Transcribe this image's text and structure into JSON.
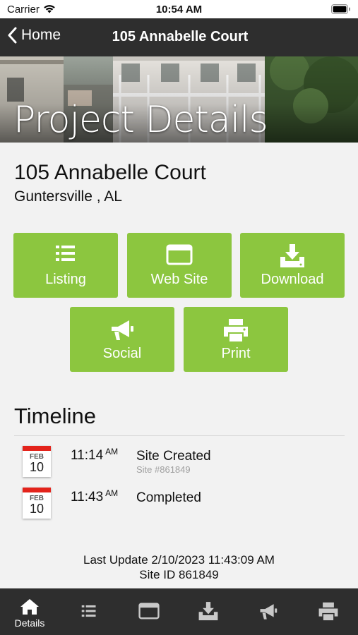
{
  "status_bar": {
    "carrier": "Carrier",
    "time": "10:54 AM"
  },
  "nav": {
    "back_label": "Home",
    "title": "105 Annabelle Court"
  },
  "hero": {
    "title": "Project Details"
  },
  "project": {
    "address": "105 Annabelle Court",
    "city": "Guntersville , AL"
  },
  "actions": [
    {
      "label": "Listing",
      "icon": "list-icon"
    },
    {
      "label": "Web Site",
      "icon": "browser-window-icon"
    },
    {
      "label": "Download",
      "icon": "download-icon"
    },
    {
      "label": "Social",
      "icon": "megaphone-icon"
    },
    {
      "label": "Print",
      "icon": "printer-icon"
    }
  ],
  "timeline": {
    "heading": "Timeline",
    "events": [
      {
        "month": "FEB",
        "day": "10",
        "time": "11:14",
        "ampm": "AM",
        "title": "Site Created",
        "subtitle": "Site #861849"
      },
      {
        "month": "FEB",
        "day": "10",
        "time": "11:43",
        "ampm": "AM",
        "title": "Completed",
        "subtitle": ""
      }
    ]
  },
  "footer": {
    "last_update": "Last Update 2/10/2023 11:43:09 AM",
    "site_id": "Site ID 861849"
  },
  "tab_bar": {
    "items": [
      {
        "label": "Details",
        "icon": "home-icon",
        "active": true
      },
      {
        "label": "",
        "icon": "list-icon"
      },
      {
        "label": "",
        "icon": "browser-window-icon"
      },
      {
        "label": "",
        "icon": "download-icon"
      },
      {
        "label": "",
        "icon": "megaphone-icon"
      },
      {
        "label": "",
        "icon": "printer-icon"
      }
    ]
  },
  "colors": {
    "accent_green": "#8cc63f",
    "nav_dark": "#2e2e2e",
    "calendar_red": "#e3231b",
    "page_bg": "#f2f2f2"
  }
}
